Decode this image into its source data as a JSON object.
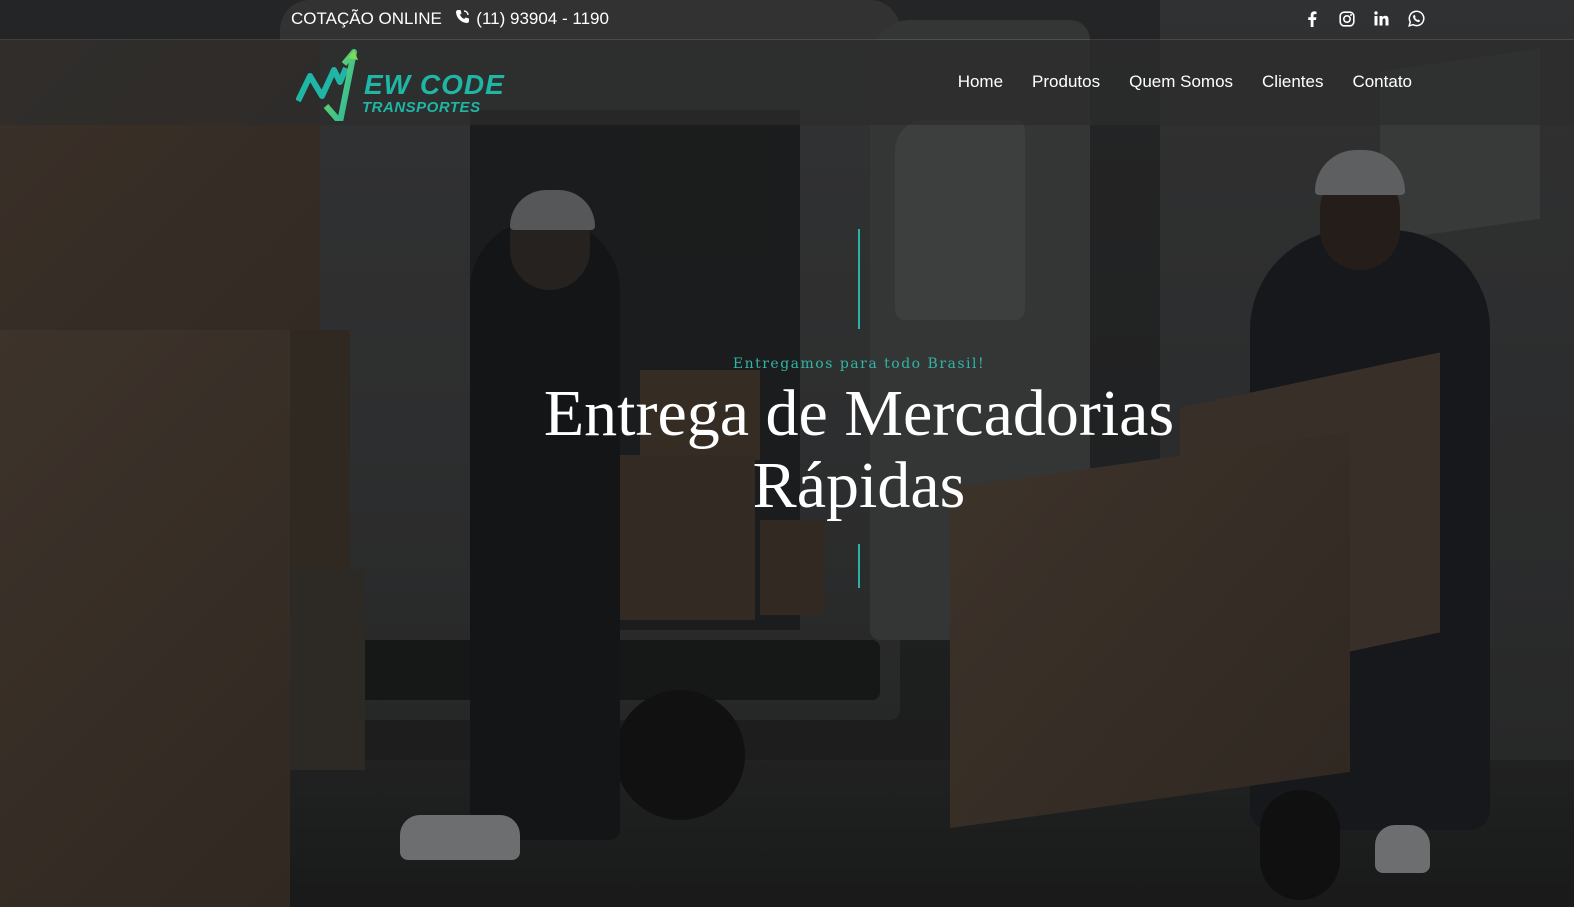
{
  "topbar": {
    "quote_label": "COTAÇÃO ONLINE",
    "phone_icon": "phone-icon",
    "phone": "(11) 93904 - 1190",
    "social": [
      "facebook-icon",
      "instagram-icon",
      "linkedin-icon",
      "whatsapp-icon"
    ]
  },
  "brand": {
    "logo_line1": "EW CODE",
    "logo_line2": "TRANSPORTES",
    "colors": {
      "teal": "#1fb6a6",
      "green": "#7ed957",
      "accent": "#28b3a6"
    }
  },
  "nav": {
    "items": [
      {
        "label": "Home"
      },
      {
        "label": "Produtos"
      },
      {
        "label": "Quem Somos"
      },
      {
        "label": "Clientes"
      },
      {
        "label": "Contato"
      }
    ]
  },
  "hero": {
    "tagline": "Entregamos para todo Brasil!",
    "headline_line1": "Entrega de Mercadorias",
    "headline_line2": "Rápidas"
  }
}
